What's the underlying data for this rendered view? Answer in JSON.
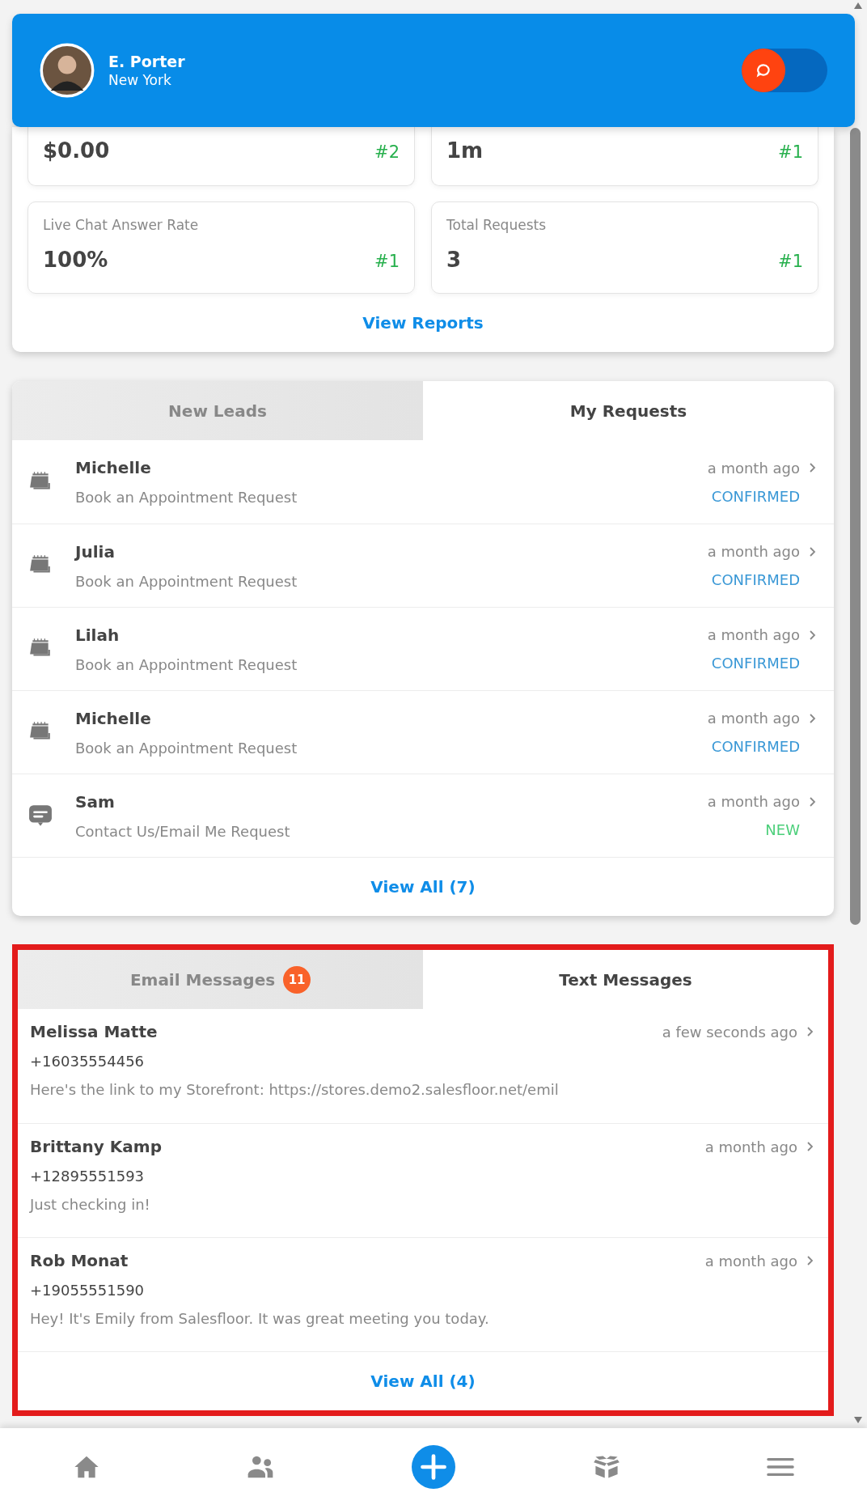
{
  "profile": {
    "name": "E. Porter",
    "location": "New York",
    "chat_on": false
  },
  "stats": {
    "cards": [
      {
        "value": "$0.00",
        "rank": "#2"
      },
      {
        "value": "1m",
        "rank": "#1"
      },
      {
        "label": "Live Chat Answer Rate",
        "value": "100%",
        "rank": "#1"
      },
      {
        "label": "Total Requests",
        "value": "3",
        "rank": "#1"
      }
    ],
    "link": "View Reports"
  },
  "requests": {
    "tabs": [
      {
        "label": "New Leads",
        "selected": false
      },
      {
        "label": "My Requests",
        "selected": true
      }
    ],
    "items": [
      {
        "kind": "appointment",
        "name": "Michelle",
        "subject": "Book an Appointment Request",
        "time": "a month ago",
        "status": "CONFIRMED",
        "color": "#3a98d6"
      },
      {
        "kind": "appointment",
        "name": "Julia",
        "subject": "Book an Appointment Request",
        "time": "a month ago",
        "status": "CONFIRMED",
        "color": "#3a98d6"
      },
      {
        "kind": "appointment",
        "name": "Lilah",
        "subject": "Book an Appointment Request",
        "time": "a month ago",
        "status": "CONFIRMED",
        "color": "#3a98d6"
      },
      {
        "kind": "appointment",
        "name": "Michelle",
        "subject": "Book an Appointment Request",
        "time": "a month ago",
        "status": "CONFIRMED",
        "color": "#3a98d6"
      },
      {
        "kind": "message",
        "name": "Sam",
        "subject": "Contact Us/Email Me Request",
        "time": "a month ago",
        "status": "NEW",
        "color": "#4ccf7a"
      }
    ],
    "link": "View All (7)"
  },
  "messages": {
    "highlighted": true,
    "tabs": [
      {
        "label": "Email Messages",
        "badge": "11",
        "selected": false
      },
      {
        "label": "Text Messages",
        "selected": true
      }
    ],
    "items": [
      {
        "name": "Melissa Matte",
        "phone": "+16035554456",
        "text": "Here's the link to my Storefront: https://stores.demo2.salesfloor.net/emil",
        "time": "a few seconds ago"
      },
      {
        "name": "Brittany Kamp",
        "phone": "+12895551593",
        "text": "Just checking in!",
        "time": "a month ago"
      },
      {
        "name": "Rob Monat",
        "phone": "+19055551590",
        "text": "Hey! It's Emily from Salesfloor. It was great meeting you today.",
        "time": "a month ago"
      }
    ],
    "link": "View All (4)"
  },
  "nav": [
    {
      "kind": "home"
    },
    {
      "kind": "people"
    },
    {
      "kind": "add"
    },
    {
      "kind": "box"
    },
    {
      "kind": "menu"
    }
  ]
}
